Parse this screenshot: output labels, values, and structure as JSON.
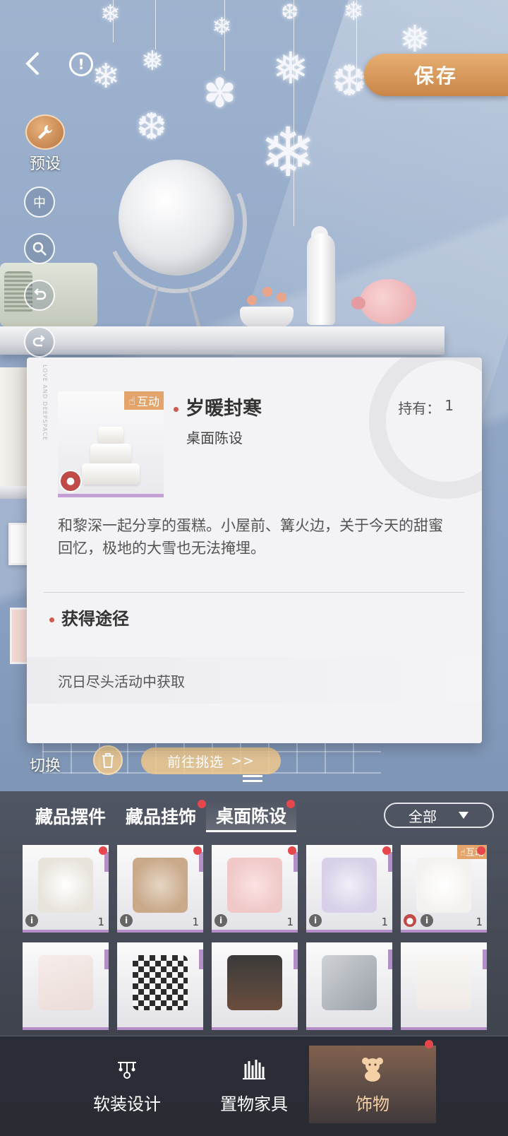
{
  "header": {
    "save_label": "保存"
  },
  "tools": {
    "preset_label": "预设",
    "center_label": "中",
    "switch_label": "切换"
  },
  "actions": {
    "goto_label": "前往挑选",
    "goto_arrow": ">>"
  },
  "detail": {
    "interact_tag": "互动",
    "name": "岁暖封寒",
    "category": "桌面陈设",
    "owned_label": "持有：",
    "owned_count": "1",
    "description": "和黎深一起分享的蛋糕。小屋前、篝火边，关于今天的甜蜜回忆，极地的大雪也无法掩埋。",
    "source_title": "获得途径",
    "source_text": "沉日尽头活动中获取",
    "side_text": "LOVE AND DEEPSPACE"
  },
  "panel": {
    "tabs": [
      {
        "label": "藏品摆件",
        "active": false
      },
      {
        "label": "藏品挂饰",
        "active": false
      },
      {
        "label": "桌面陈设",
        "active": true
      }
    ],
    "filter_label": "全部",
    "items": [
      {
        "count": "1",
        "color": "#e8e4dc"
      },
      {
        "count": "1",
        "color": "#c9a98a"
      },
      {
        "count": "1",
        "color": "#f0c8c8"
      },
      {
        "count": "1",
        "color": "#d8d0e8"
      },
      {
        "count": "1",
        "color": "#f4f2ee",
        "tag": "互动"
      },
      {
        "count": "",
        "color": "#eadcd8"
      },
      {
        "count": "",
        "color": "#2c2c2c"
      },
      {
        "count": "",
        "color": "#6a4e3e"
      },
      {
        "count": "",
        "color": "#9aa0a8"
      },
      {
        "count": "",
        "color": "#efeae6"
      }
    ]
  },
  "nav": {
    "items": [
      {
        "label": "软装设计",
        "icon": "chandelier-icon"
      },
      {
        "label": "置物家具",
        "icon": "bookshelf-icon"
      },
      {
        "label": "饰物",
        "icon": "teddy-bear-icon"
      }
    ]
  },
  "colors": {
    "accent": "#c98648",
    "badge_red": "#e6474d",
    "rarity_purple": "#b48fc7"
  }
}
